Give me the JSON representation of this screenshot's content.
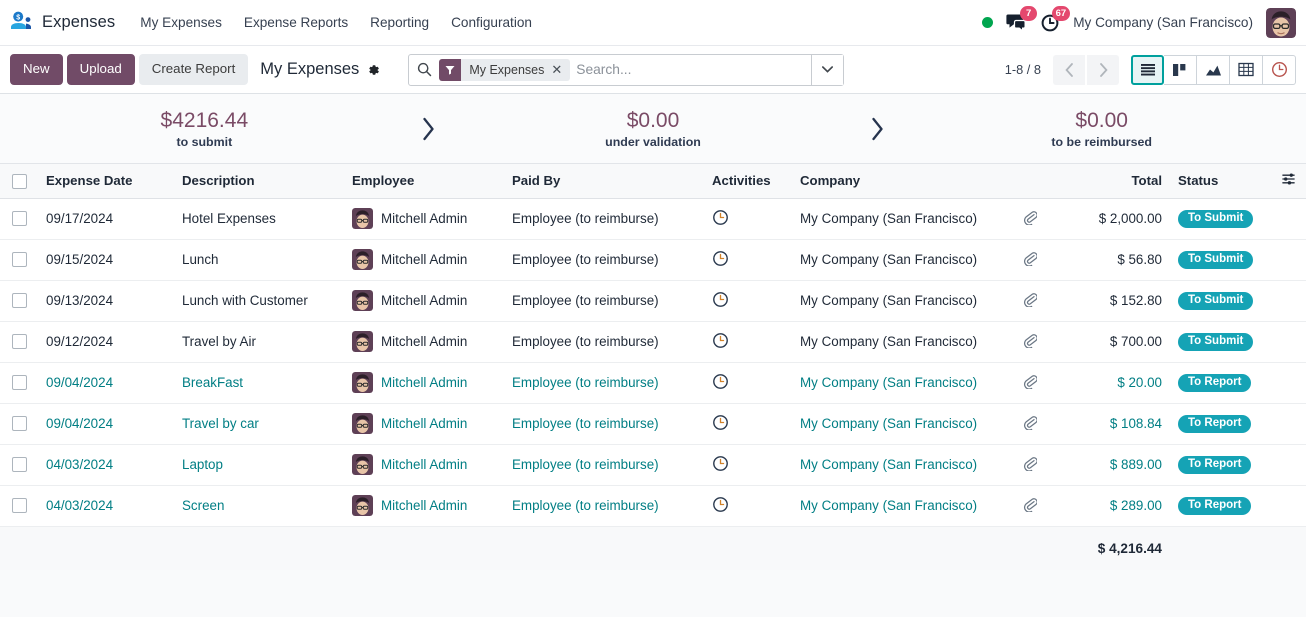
{
  "navbar": {
    "app_icon": "expenses-app-icon",
    "brand": "Expenses",
    "menu": [
      {
        "label": "My Expenses"
      },
      {
        "label": "Expense Reports"
      },
      {
        "label": "Reporting"
      },
      {
        "label": "Configuration"
      }
    ],
    "presence_dot_color": "#00a54f",
    "messages_icon": "messages-icon",
    "messages_count": "7",
    "activities_icon": "activities-clock-icon",
    "activities_count": "67",
    "company": "My Company (San Francisco)",
    "avatar": "user-avatar"
  },
  "control_panel": {
    "new_label": "New",
    "upload_label": "Upload",
    "create_report_label": "Create Report",
    "breadcrumb_title": "My Expenses",
    "gear_icon": "gear-icon",
    "search": {
      "search_icon": "search-icon",
      "facet_icon": "filter-icon",
      "facet_label": "My Expenses",
      "facet_remove": "✕",
      "placeholder": "Search...",
      "dropdown_icon": "chevron-down-icon"
    },
    "pager": "1-8 / 8",
    "prev_icon": "chevron-left-icon",
    "next_icon": "chevron-right-icon",
    "views": [
      {
        "name": "list-view",
        "icon": "list-icon",
        "active": true
      },
      {
        "name": "kanban-view",
        "icon": "kanban-icon",
        "active": false
      },
      {
        "name": "graph-view",
        "icon": "graph-icon",
        "active": false
      },
      {
        "name": "pivot-view",
        "icon": "pivot-icon",
        "active": false
      },
      {
        "name": "activity-view",
        "icon": "clock-icon",
        "active": false
      }
    ]
  },
  "status_banner": {
    "cells": [
      {
        "amount": "$4216.44",
        "label": "to submit"
      },
      {
        "amount": "$0.00",
        "label": "under validation"
      },
      {
        "amount": "$0.00",
        "label": "to be reimbursed"
      }
    ],
    "arrow_icon": "chevron-right-icon"
  },
  "table": {
    "headers": {
      "expense_date": "Expense Date",
      "description": "Description",
      "employee": "Employee",
      "paid_by": "Paid By",
      "activities": "Activities",
      "company": "Company",
      "total": "Total",
      "status": "Status",
      "options_icon": "column-options-icon"
    },
    "rows": [
      {
        "date": "09/17/2024",
        "description": "Hotel Expenses",
        "employee": "Mitchell Admin",
        "paid_by": "Employee (to reimburse)",
        "activity_icon": "clock-icon",
        "company": "My Company (San Francisco)",
        "attachment_icon": "paperclip-icon",
        "total": "$ 2,000.00",
        "status": "To Submit",
        "link": false
      },
      {
        "date": "09/15/2024",
        "description": "Lunch",
        "employee": "Mitchell Admin",
        "paid_by": "Employee (to reimburse)",
        "activity_icon": "clock-icon",
        "company": "My Company (San Francisco)",
        "attachment_icon": "paperclip-icon",
        "total": "$ 56.80",
        "status": "To Submit",
        "link": false
      },
      {
        "date": "09/13/2024",
        "description": "Lunch with Customer",
        "employee": "Mitchell Admin",
        "paid_by": "Employee (to reimburse)",
        "activity_icon": "clock-icon",
        "company": "My Company (San Francisco)",
        "attachment_icon": "paperclip-icon",
        "total": "$ 152.80",
        "status": "To Submit",
        "link": false
      },
      {
        "date": "09/12/2024",
        "description": "Travel by Air",
        "employee": "Mitchell Admin",
        "paid_by": "Employee (to reimburse)",
        "activity_icon": "clock-icon",
        "company": "My Company (San Francisco)",
        "attachment_icon": "paperclip-icon",
        "total": "$ 700.00",
        "status": "To Submit",
        "link": false
      },
      {
        "date": "09/04/2024",
        "description": "BreakFast",
        "employee": "Mitchell Admin",
        "paid_by": "Employee (to reimburse)",
        "activity_icon": "clock-icon",
        "company": "My Company (San Francisco)",
        "attachment_icon": "paperclip-icon",
        "total": "$ 20.00",
        "status": "To Report",
        "link": true
      },
      {
        "date": "09/04/2024",
        "description": "Travel by car",
        "employee": "Mitchell Admin",
        "paid_by": "Employee (to reimburse)",
        "activity_icon": "clock-icon",
        "company": "My Company (San Francisco)",
        "attachment_icon": "paperclip-icon",
        "total": "$ 108.84",
        "status": "To Report",
        "link": true
      },
      {
        "date": "04/03/2024",
        "description": "Laptop",
        "employee": "Mitchell Admin",
        "paid_by": "Employee (to reimburse)",
        "activity_icon": "clock-icon",
        "company": "My Company (San Francisco)",
        "attachment_icon": "paperclip-icon",
        "total": "$ 889.00",
        "status": "To Report",
        "link": true
      },
      {
        "date": "04/03/2024",
        "description": "Screen",
        "employee": "Mitchell Admin",
        "paid_by": "Employee (to reimburse)",
        "activity_icon": "clock-icon",
        "company": "My Company (San Francisco)",
        "attachment_icon": "paperclip-icon",
        "total": "$ 289.00",
        "status": "To Report",
        "link": true
      }
    ],
    "footer_total": "$ 4,216.44"
  },
  "colors": {
    "brand_purple": "#714b67",
    "badge_teal": "#15a3b5",
    "link_teal": "#017e84",
    "amount_purple": "#7a4b66",
    "notification_red": "#e4486e",
    "presence_green": "#00a54f"
  }
}
